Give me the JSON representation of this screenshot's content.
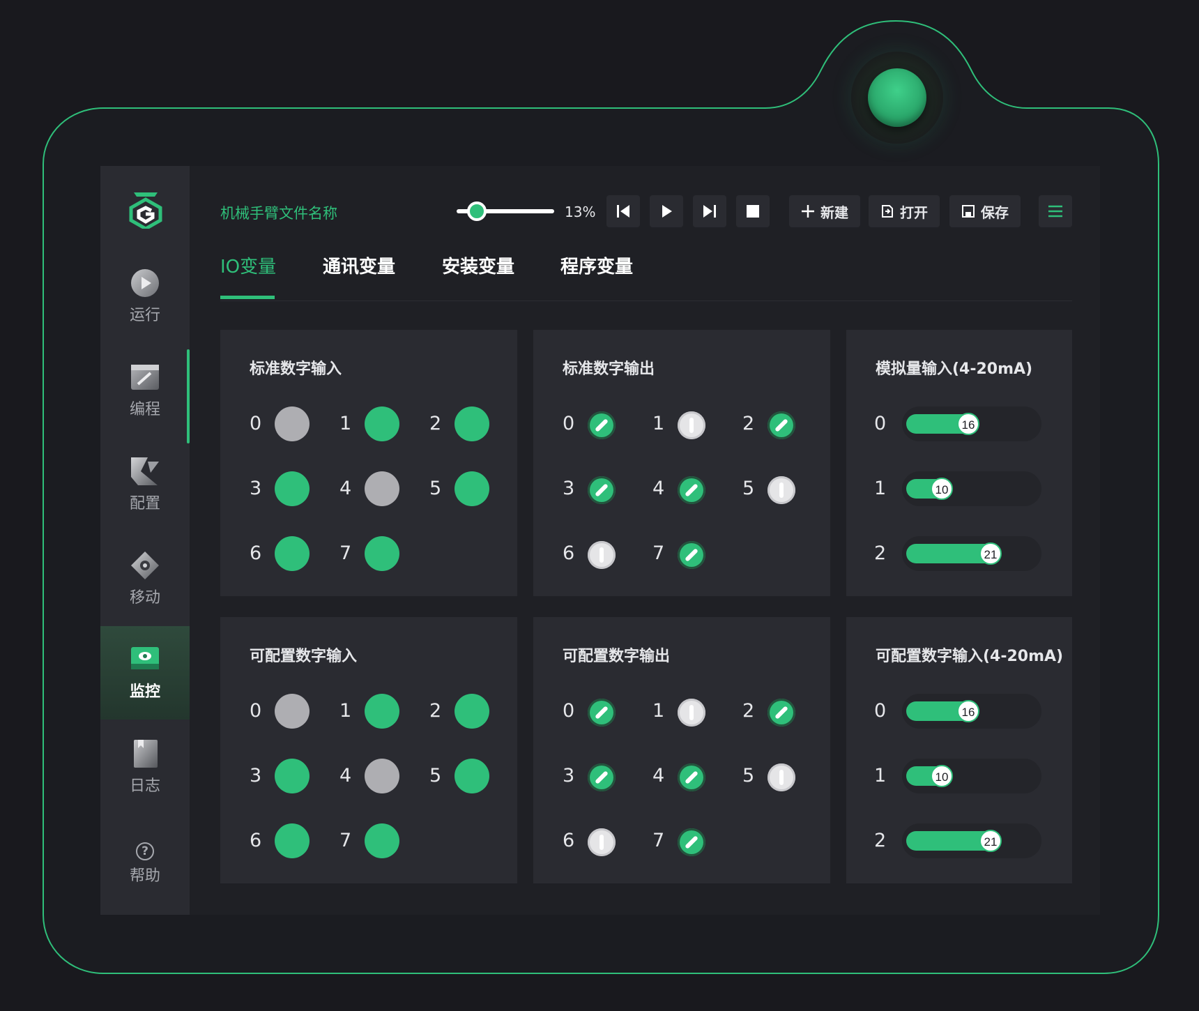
{
  "sidebar": {
    "items": [
      {
        "label": "运行",
        "icon": "run-icon"
      },
      {
        "label": "编程",
        "icon": "program-icon"
      },
      {
        "label": "配置",
        "icon": "config-icon"
      },
      {
        "label": "移动",
        "icon": "move-icon"
      },
      {
        "label": "监控",
        "icon": "monitor-icon",
        "active": true
      },
      {
        "label": "日志",
        "icon": "log-icon"
      }
    ],
    "help_label": "帮助"
  },
  "toolbar": {
    "file_name": "机械手臂文件名称",
    "speed_percent": 13,
    "speed_label": "13%",
    "new_label": "新建",
    "open_label": "打开",
    "save_label": "保存"
  },
  "tabs": [
    {
      "label": "IO变量",
      "active": true
    },
    {
      "label": "通讯变量"
    },
    {
      "label": "安装变量"
    },
    {
      "label": "程序变量"
    }
  ],
  "panels": {
    "std_di": {
      "title": "标准数字输入",
      "states": [
        false,
        true,
        true,
        true,
        false,
        true,
        true,
        true
      ]
    },
    "std_do": {
      "title": "标准数字输出",
      "states": [
        true,
        false,
        true,
        true,
        true,
        false,
        false,
        true
      ]
    },
    "ai": {
      "title": "模拟量输入(4-20mA)",
      "values": [
        16,
        10,
        21
      ]
    },
    "cfg_di": {
      "title": "可配置数字输入",
      "states": [
        false,
        true,
        true,
        true,
        false,
        true,
        true,
        true
      ]
    },
    "cfg_do": {
      "title": "可配置数字输出",
      "states": [
        true,
        false,
        true,
        true,
        true,
        false,
        false,
        true
      ]
    },
    "cfg_ai": {
      "title": "可配置数字输入(4-20mA)",
      "values": [
        16,
        10,
        21
      ]
    }
  },
  "colors": {
    "accent": "#2fbf7a",
    "off": "#aeaeb2",
    "panel": "#2a2b31",
    "background": "#1f2025"
  }
}
